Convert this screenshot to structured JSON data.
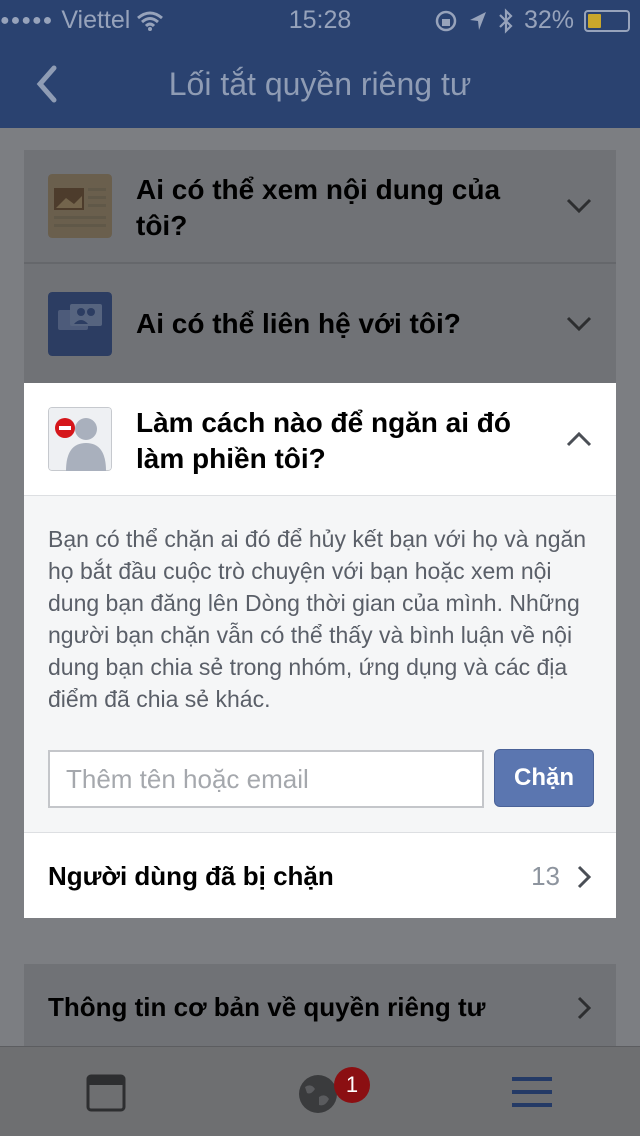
{
  "status_bar": {
    "carrier": "Viettel",
    "time": "15:28",
    "battery": "32%",
    "battery_level": 0.32
  },
  "nav": {
    "title": "Lối tắt quyền riêng tư",
    "back_icon": "chevron-left-icon"
  },
  "sections": [
    {
      "title": "Ai có thể xem nội dung của tôi?",
      "icon": "newspaper-icon"
    },
    {
      "title": "Ai có thể liên hệ với tôi?",
      "icon": "chat-people-icon"
    }
  ],
  "block_panel": {
    "title": "Làm cách nào để ngăn ai đó làm phiền tôi?",
    "icon": "blocked-person-icon",
    "description": "Bạn có thể chặn ai đó để hủy kết bạn với họ và ngăn họ bắt đầu cuộc trò chuyện với bạn hoặc xem nội dung bạn đăng lên Dòng thời gian của mình. Những người bạn chặn vẫn có thể thấy và bình luận về nội dung bạn chia sẻ trong nhóm, ứng dụng và các địa điểm đã chia sẻ khác.",
    "input_placeholder": "Thêm tên hoặc email",
    "block_button": "Chặn",
    "blocked_users_label": "Người dùng đã bị chặn",
    "blocked_users_count": "13"
  },
  "privacy_basics": {
    "label": "Thông tin cơ bản về quyền riêng tư"
  },
  "tab_bar": {
    "tabs": [
      "news-feed-icon",
      "globe-notifications-icon",
      "menu-icon"
    ],
    "notification_badge": "1"
  },
  "colors": {
    "header": "#2a4270",
    "overlay": "#7c7e82",
    "button": "#5b76b0"
  }
}
